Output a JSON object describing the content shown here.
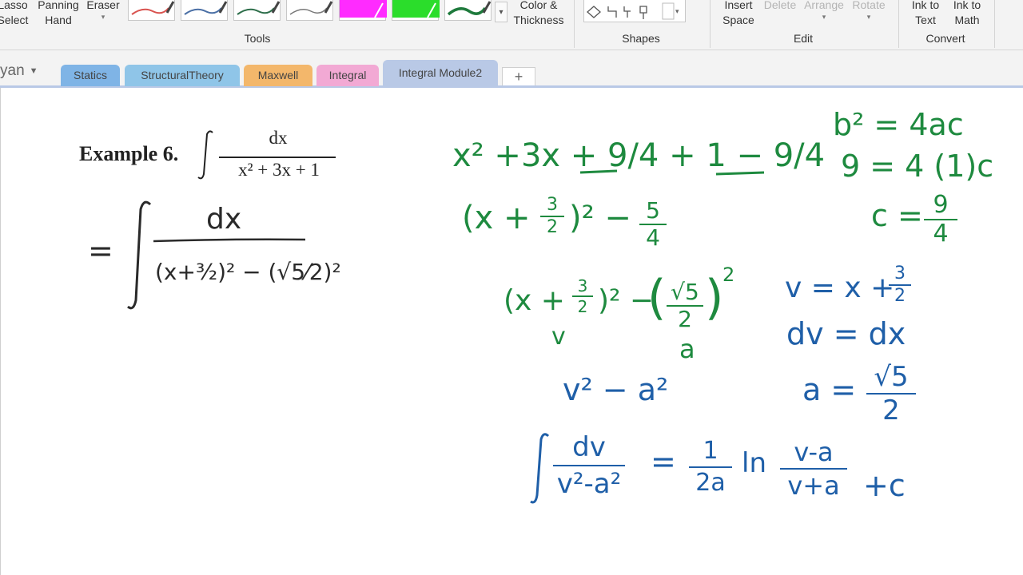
{
  "ribbon": {
    "lasso_select": "Lasso\nSelect",
    "panning_hand": "Panning\nHand",
    "eraser": "Eraser",
    "color_thickness": "Color &\nThickness",
    "tools_label": "Tools",
    "shapes_label": "Shapes",
    "insert_space": "Insert\nSpace",
    "delete": "Delete",
    "arrange": "Arrange",
    "rotate": "Rotate",
    "edit_label": "Edit",
    "ink_to_text": "Ink to\nText",
    "ink_to_math": "Ink to\nMath",
    "convert_label": "Convert",
    "pens": [
      {
        "name": "pen-red-thin",
        "color": "#d9534f"
      },
      {
        "name": "pen-blue-thin",
        "color": "#4a6fa5"
      },
      {
        "name": "pen-dark-thin",
        "color": "#2d6e4a"
      },
      {
        "name": "pen-gray-thin",
        "color": "#777777"
      },
      {
        "name": "highlighter-magenta",
        "color": "#ff2bff"
      },
      {
        "name": "highlighter-green",
        "color": "#2bdd2b"
      },
      {
        "name": "pen-green-thick",
        "color": "#1e7a3c"
      }
    ]
  },
  "notebook": {
    "name_partial": "yan"
  },
  "tabs": [
    {
      "label": "Statics",
      "color": "#7fb4e6"
    },
    {
      "label": "StructuralTheory",
      "color": "#8fc5e8"
    },
    {
      "label": "Maxwell",
      "color": "#f3b76b"
    },
    {
      "label": "Integral",
      "color": "#f2a9d4"
    },
    {
      "label": "Integral Module2",
      "color": "#b9c9e6",
      "active": true
    }
  ],
  "add_tab": "+",
  "page": {
    "example_label": "Example 6.",
    "example_integral": {
      "numerator": "dx",
      "denominator": "x² + 3x + 1"
    },
    "black_ink": {
      "equals": "=",
      "numerator": "dx",
      "denominator": "(x+³⁄₂)² − (√5⁄2)²"
    },
    "green_ink": {
      "line1": "x² +3x + 9/4  + 1 − 9/4",
      "line2_left": "(x + ",
      "line2_frac_num": "3",
      "line2_frac_den": "2",
      "line2_right": ")² − ",
      "line2_frac2_num": "5",
      "line2_frac2_den": "4",
      "b2": "b² = 4ac",
      "nine": "9 = 4 (1)c",
      "c_eq": "c = ",
      "c_num": "9",
      "c_den": "4"
    },
    "blue_green_ink": {
      "line3_left": "(x + ",
      "line3_frac_num": "3",
      "line3_frac_den": "2",
      "line3_mid": ")² − ",
      "line3_paren_num": "√5",
      "line3_paren_den": "2",
      "line3_sq": "2",
      "v_label": "v",
      "a_label": "a"
    },
    "blue_ink": {
      "v_def_left": "v = x + ",
      "v_def_num": "3",
      "v_def_den": "2",
      "dv": "dv = dx",
      "v2a2": "v² − a²",
      "a_eq": "a = ",
      "a_num": "√5",
      "a_den": "2",
      "int_num": "dv",
      "int_den": "v²-a²",
      "equals": "=",
      "one": "1",
      "two_a": "2a",
      "ln": "ln",
      "ln_num": "v-a",
      "ln_den": "v+a",
      "plus_c": "+c"
    }
  }
}
